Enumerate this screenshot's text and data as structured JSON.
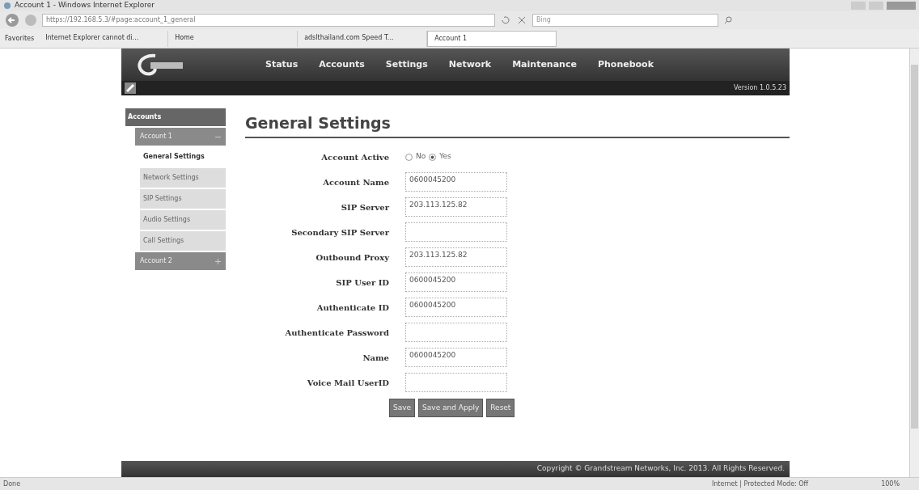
{
  "window": {
    "title": "Account 1 - Windows Internet Explorer"
  },
  "address_bar": {
    "url": "https://192.168.5.3/#page:account_1_general",
    "search_placeholder": "Bing"
  },
  "favorites_bar": {
    "label": "Favorites",
    "tabs": [
      {
        "label": "Internet Explorer cannot di...",
        "selected": false
      },
      {
        "label": "Home",
        "selected": false
      },
      {
        "label": "adslthailand.com Speed T...",
        "selected": false
      },
      {
        "label": "Account 1",
        "selected": true
      }
    ]
  },
  "header": {
    "nav": [
      "Status",
      "Accounts",
      "Settings",
      "Network",
      "Maintenance",
      "Phonebook"
    ],
    "version": "Version 1.0.5.23"
  },
  "sidebar": {
    "title": "Accounts",
    "items": [
      {
        "label": "Account 1",
        "expanded": true,
        "children": [
          {
            "label": "General Settings",
            "selected": true
          },
          {
            "label": "Network Settings",
            "selected": false
          },
          {
            "label": "SIP Settings",
            "selected": false
          },
          {
            "label": "Audio Settings",
            "selected": false
          },
          {
            "label": "Call Settings",
            "selected": false
          }
        ]
      },
      {
        "label": "Account 2",
        "expanded": false
      }
    ]
  },
  "form": {
    "title": "General Settings",
    "fields": [
      {
        "kind": "radio",
        "label": "Account Active",
        "options": [
          {
            "label": "No",
            "selected": false
          },
          {
            "label": "Yes",
            "selected": true
          }
        ]
      },
      {
        "kind": "text",
        "label": "Account Name",
        "value": "0600045200"
      },
      {
        "kind": "text",
        "label": "SIP Server",
        "value": "203.113.125.82"
      },
      {
        "kind": "text",
        "label": "Secondary SIP Server"
      },
      {
        "kind": "text",
        "label": "Outbound Proxy",
        "value": "203.113.125.82"
      },
      {
        "kind": "text",
        "label": "SIP User ID",
        "value": "0600045200"
      },
      {
        "kind": "text",
        "label": "Authenticate ID",
        "value": "0600045200"
      },
      {
        "kind": "text",
        "label": "Authenticate Password"
      },
      {
        "kind": "text",
        "label": "Name",
        "value": "0600045200"
      },
      {
        "kind": "text",
        "label": "Voice Mail UserID"
      }
    ],
    "buttons": [
      "Save",
      "Save and Apply",
      "Reset"
    ]
  },
  "footer": {
    "copyright": "Copyright © Grandstream Networks, Inc. 2013. All Rights Reserved."
  },
  "status_bar": {
    "status": "Done",
    "zone": "Internet | Protected Mode: Off",
    "zoom": "100%"
  }
}
